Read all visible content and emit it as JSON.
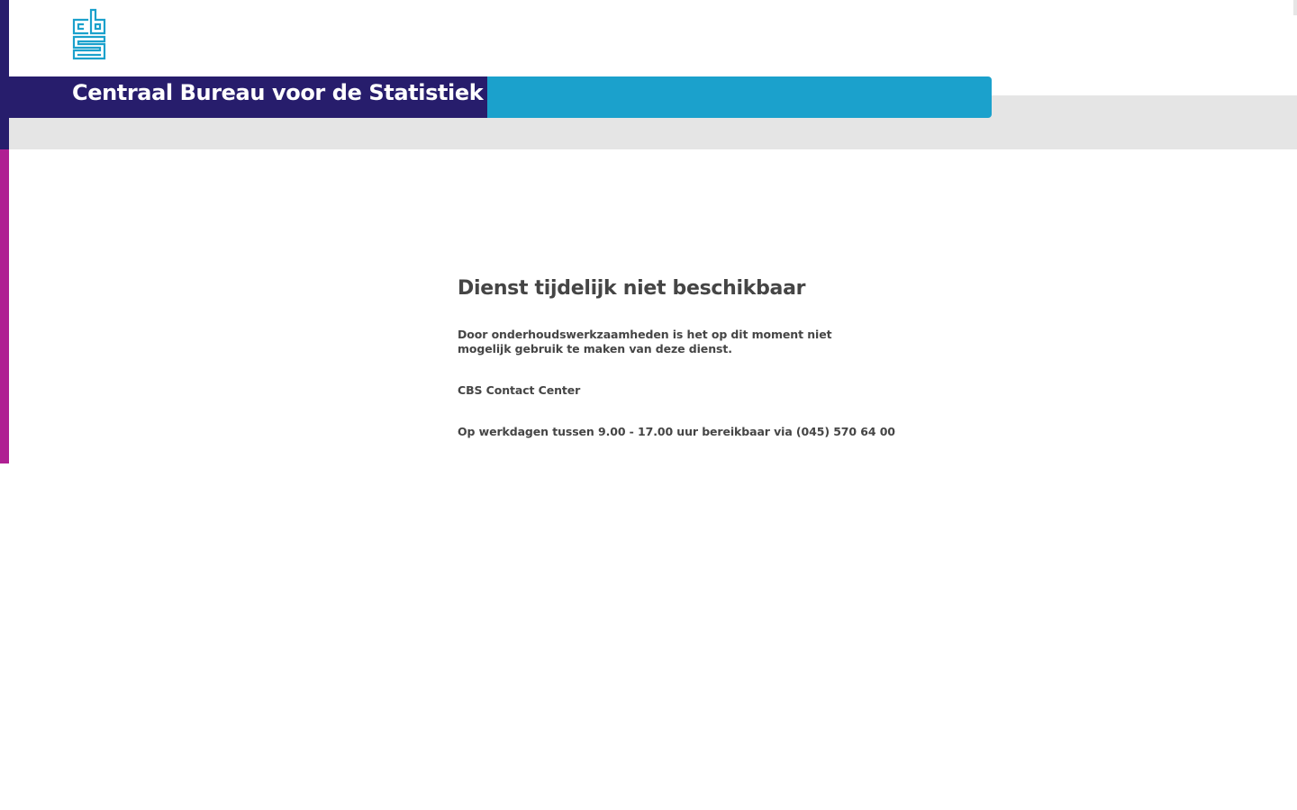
{
  "header": {
    "organization_title": "Centraal Bureau voor de Statistiek",
    "logo_icon": "cbs-logo-icon"
  },
  "main": {
    "heading": "Dienst tijdelijk niet beschikbaar",
    "message": "Door onderhoudswerkzaamheden is het op dit moment niet mogelijk gebruik te maken van deze dienst.",
    "contact_title": "CBS Contact Center",
    "contact_hours": "Op werkdagen tussen 9.00 - 17.00 uur bereikbaar via (045) 570 64 00"
  },
  "colors": {
    "dark_blue": "#271d6c",
    "light_blue": "#1ba1cc",
    "magenta": "#af2092",
    "gray_band": "#e5e5e5",
    "text": "#454545"
  }
}
